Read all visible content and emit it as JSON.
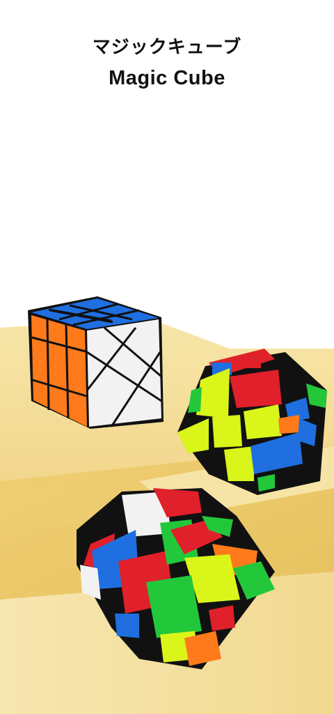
{
  "title": {
    "japanese": "マジックキューブ",
    "english": "Magic Cube"
  },
  "colors": {
    "background": "#ffffff",
    "pedestal": "#f2d58a",
    "cube_body": "#111111",
    "sticker_blue": "#1f6fe0",
    "sticker_orange": "#ff7a1a",
    "sticker_white": "#f2f2f2",
    "sticker_red": "#e0202a",
    "sticker_green": "#22c83a",
    "sticker_yellow": "#d9f51a"
  },
  "objects": [
    {
      "name": "fisher-cube",
      "description": "3x3 shape-mod cube, blue top, orange left, white right"
    },
    {
      "name": "windmill-cube",
      "description": "scrambled shape-mod cube on step, yellow front"
    },
    {
      "name": "skewed-cube",
      "description": "scrambled shape-mod cube in foreground"
    }
  ]
}
